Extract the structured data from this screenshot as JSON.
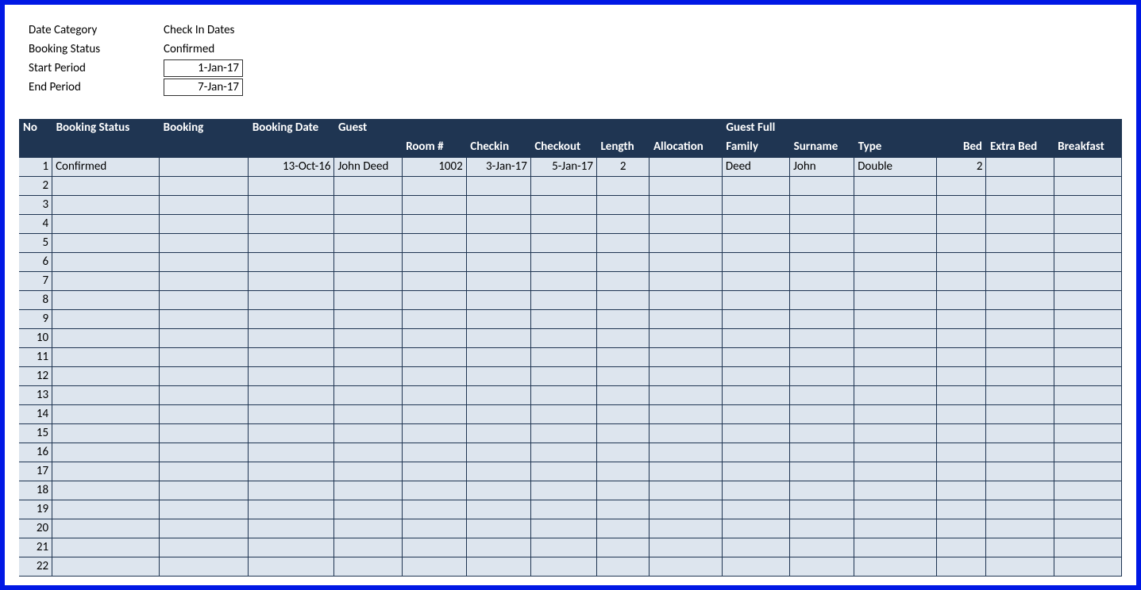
{
  "filters": {
    "rows": [
      {
        "label": "Date Category",
        "value": "Check In Dates",
        "boxed": false
      },
      {
        "label": "Booking Status",
        "value": "Confirmed",
        "boxed": false
      },
      {
        "label": "Start Period",
        "value": "1-Jan-17",
        "boxed": true
      },
      {
        "label": "End Period",
        "value": "7-Jan-17",
        "boxed": true
      }
    ]
  },
  "table": {
    "headers_row1": {
      "no": "No",
      "booking_status": "Booking Status",
      "booking": "Booking",
      "booking_date": "Booking Date",
      "guest": "Guest",
      "guest_full": "Guest Full"
    },
    "headers_row2": {
      "room": "Room #",
      "checkin": "Checkin",
      "checkout": "Checkout",
      "length": "Length",
      "allocation": "Allocation",
      "family": "Family",
      "surname": "Surname",
      "type": "Type",
      "bed": "Bed",
      "extra_bed": "Extra Bed",
      "breakfast": "Breakfast"
    },
    "rows": [
      {
        "no": "1",
        "booking_status": "Confirmed",
        "booking": "",
        "booking_date": "13-Oct-16",
        "guest": "John Deed",
        "room": "1002",
        "checkin": "3-Jan-17",
        "checkout": "5-Jan-17",
        "length": "2",
        "allocation": "",
        "family": "Deed",
        "surname": "John",
        "type": "Double",
        "bed": "2",
        "extra_bed": "",
        "breakfast": ""
      },
      {
        "no": "2"
      },
      {
        "no": "3"
      },
      {
        "no": "4"
      },
      {
        "no": "5"
      },
      {
        "no": "6"
      },
      {
        "no": "7"
      },
      {
        "no": "8"
      },
      {
        "no": "9"
      },
      {
        "no": "10"
      },
      {
        "no": "11"
      },
      {
        "no": "12"
      },
      {
        "no": "13"
      },
      {
        "no": "14"
      },
      {
        "no": "15"
      },
      {
        "no": "16"
      },
      {
        "no": "17"
      },
      {
        "no": "18"
      },
      {
        "no": "19"
      },
      {
        "no": "20"
      },
      {
        "no": "21"
      },
      {
        "no": "22"
      }
    ]
  }
}
